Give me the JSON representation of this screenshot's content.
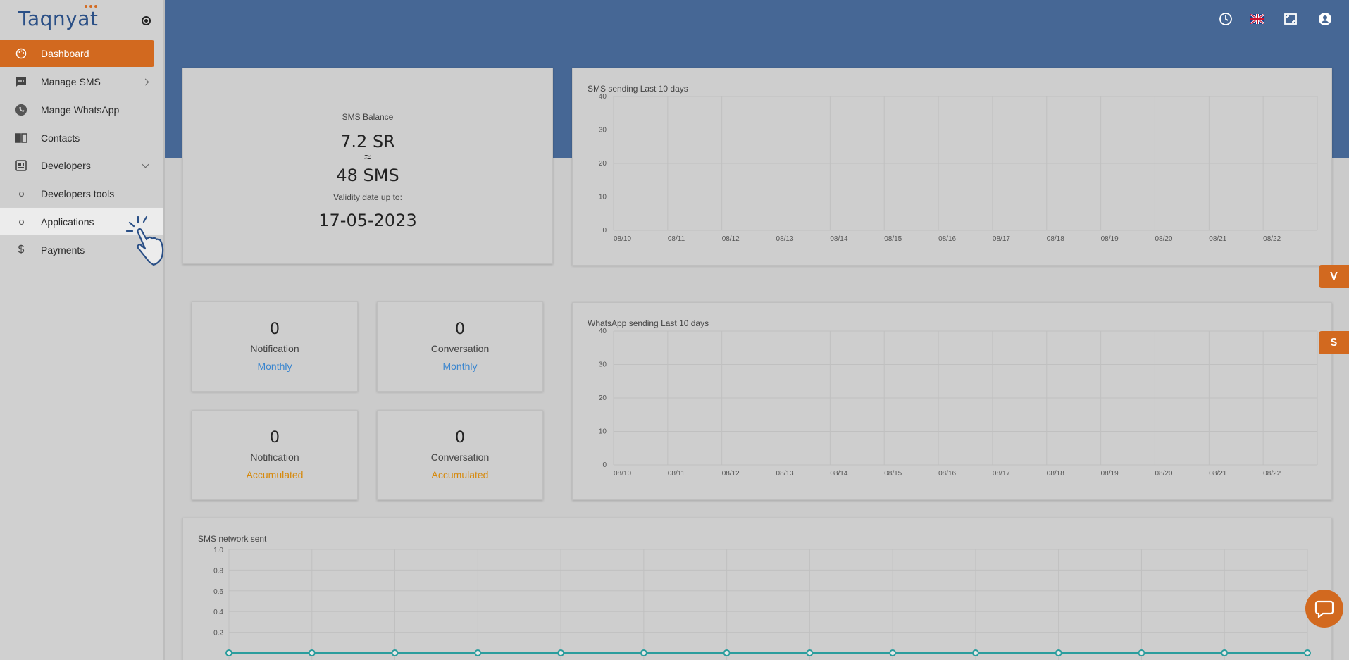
{
  "brand": {
    "name": "Taqnyat",
    "accent": "#d2691f",
    "primary": "#466795"
  },
  "sidebar": {
    "items": [
      {
        "label": "Dashboard",
        "icon": "palette-icon",
        "active": true
      },
      {
        "label": "Manage SMS",
        "icon": "message-icon",
        "has_chevron": "right"
      },
      {
        "label": "Mange WhatsApp",
        "icon": "whatsapp-icon"
      },
      {
        "label": "Contacts",
        "icon": "book-icon"
      },
      {
        "label": "Developers",
        "icon": "developer-board-icon",
        "has_chevron": "down"
      },
      {
        "label": "Developers tools",
        "icon": "circle-icon",
        "sub": true
      },
      {
        "label": "Applications",
        "icon": "circle-icon",
        "sub": true,
        "highlighted": true
      },
      {
        "label": "Payments",
        "icon": "dollar-icon"
      }
    ]
  },
  "header": {
    "icons": [
      "clock-icon",
      "uk-flag-icon",
      "fullscreen-icon",
      "account-icon"
    ]
  },
  "balance": {
    "title": "SMS Balance",
    "amount": "7.2 SR",
    "approx": "≈",
    "sms": "48 SMS",
    "validity_label": "Validity date up to:",
    "validity_date": "17-05-2023"
  },
  "stats": [
    {
      "value": "0",
      "label": "Notification",
      "period": "Monthly",
      "period_color": "#3b86cf"
    },
    {
      "value": "0",
      "label": "Conversation",
      "period": "Monthly",
      "period_color": "#3b86cf"
    },
    {
      "value": "0",
      "label": "Notification",
      "period": "Accumulated",
      "period_color": "#d6890c"
    },
    {
      "value": "0",
      "label": "Conversation",
      "period": "Accumulated",
      "period_color": "#d6890c"
    }
  ],
  "chart_data": [
    {
      "type": "line",
      "title": "SMS sending Last 10 days",
      "categories": [
        "08/10",
        "08/11",
        "08/12",
        "08/13",
        "08/14",
        "08/15",
        "08/16",
        "08/17",
        "08/18",
        "08/19",
        "08/20",
        "08/21",
        "08/22"
      ],
      "yticks": [
        "0",
        "10",
        "20",
        "30",
        "40"
      ],
      "ylim": [
        0,
        40
      ],
      "series": [],
      "grid": true
    },
    {
      "type": "line",
      "title": "WhatsApp sending Last 10 days",
      "categories": [
        "08/10",
        "08/11",
        "08/12",
        "08/13",
        "08/14",
        "08/15",
        "08/16",
        "08/17",
        "08/18",
        "08/19",
        "08/20",
        "08/21",
        "08/22"
      ],
      "yticks": [
        "0",
        "10",
        "20",
        "30",
        "40"
      ],
      "ylim": [
        0,
        40
      ],
      "series": [],
      "grid": true
    },
    {
      "type": "line",
      "title": "SMS network sent",
      "yticks": [
        "0.2",
        "0.4",
        "0.6",
        "0.8",
        "1.0"
      ],
      "ylim": [
        0,
        1.0
      ],
      "series": [
        {
          "values": [
            0,
            0,
            0,
            0,
            0,
            0,
            0,
            0,
            0,
            0,
            0,
            0,
            0,
            0
          ],
          "color": "#2a9d9d"
        }
      ],
      "grid": true
    }
  ],
  "side_tabs": [
    {
      "label": "V",
      "icon": "filter-icon"
    },
    {
      "label": "$",
      "icon": "dollar-icon"
    }
  ],
  "chat": {
    "icon": "chat-icon"
  }
}
